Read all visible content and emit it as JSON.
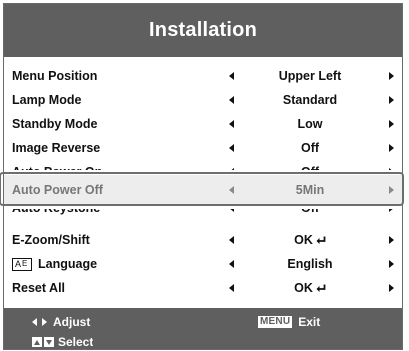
{
  "title": "Installation",
  "rows": [
    {
      "label": "Menu Position",
      "value": "Upper Left"
    },
    {
      "label": "Lamp Mode",
      "value": "Standard"
    },
    {
      "label": "Standby Mode",
      "value": "Low"
    },
    {
      "label": "Image Reverse",
      "value": "Off"
    },
    {
      "label": "Auto Power On",
      "value": "Off"
    },
    {
      "label": "Auto Power Off",
      "value": "5Min"
    },
    {
      "label": "Auto Keystone",
      "value": "Off"
    },
    {
      "label": "E-Zoom/Shift",
      "value": "OK"
    },
    {
      "label": "Language",
      "value": "English"
    },
    {
      "label": "Reset All",
      "value": "OK"
    }
  ],
  "language_icon_text": {
    "a": "A",
    "e": "E"
  },
  "footer": {
    "adjust_label": "Adjust",
    "menu_key": "MENU",
    "exit_label": "Exit",
    "select_label": "Select"
  },
  "icons": {
    "left": "triangle-left-icon",
    "right": "triangle-right-icon",
    "enter": "enter-return-icon",
    "language": "language-icon",
    "up_down": "up-down-keys-icon"
  },
  "colors": {
    "header_bg": "#5f5f5f",
    "selected_bg": "#ededed",
    "selected_text": "#777777",
    "frame": "#6e6e6e"
  }
}
